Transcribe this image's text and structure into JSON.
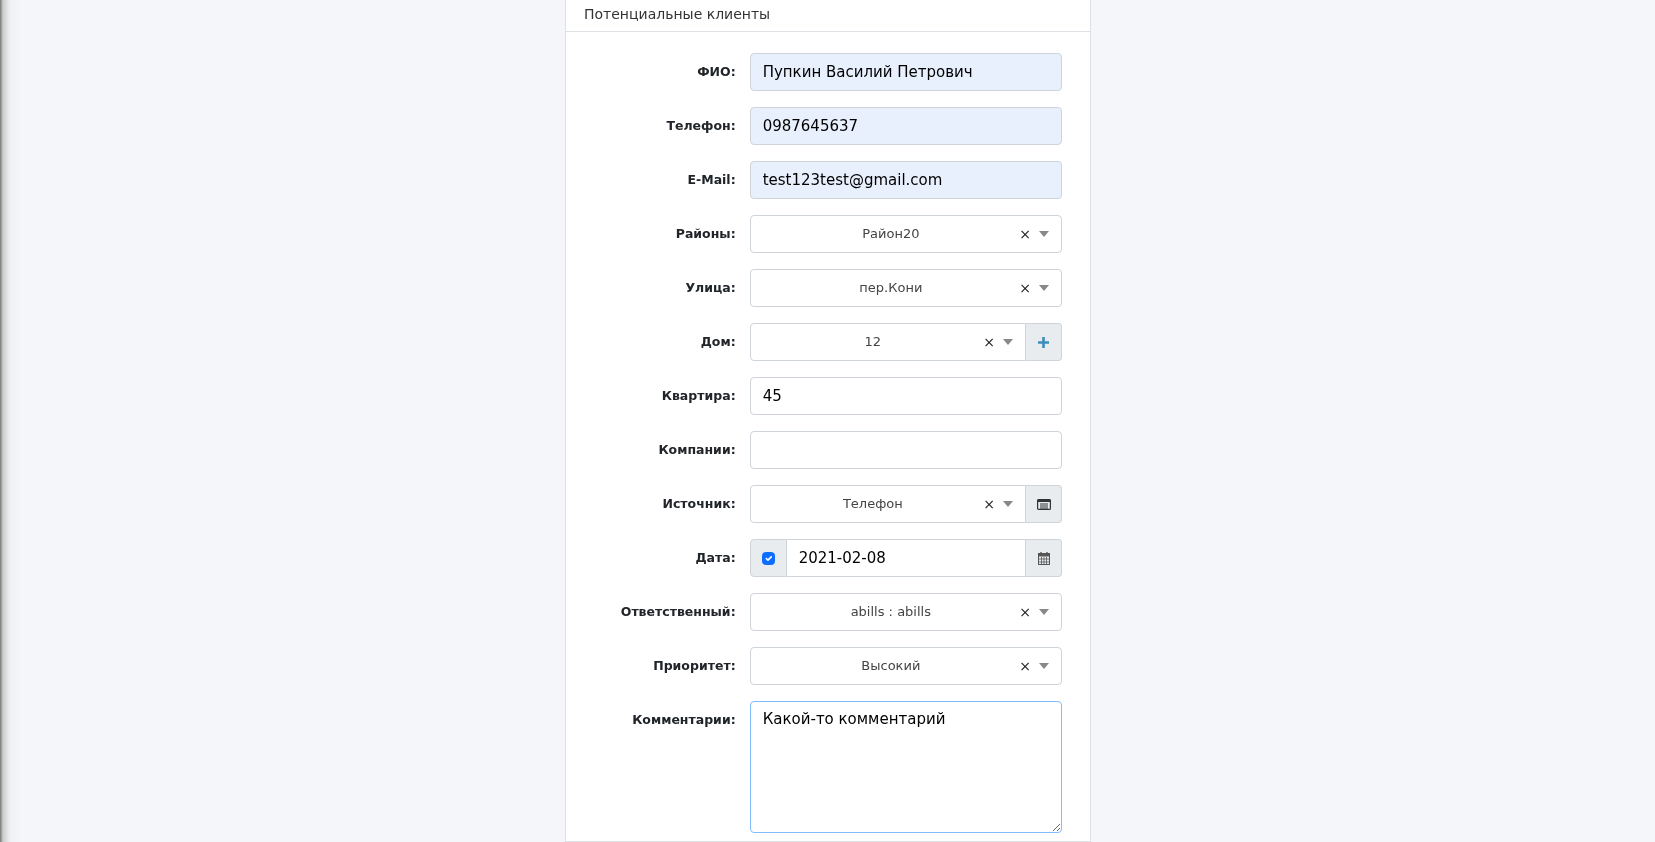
{
  "card": {
    "title": "Потенциальные клиенты"
  },
  "fields": [
    {
      "kind": "text",
      "label": "ФИО:",
      "value": "Пупкин Василий Петрович",
      "autofilled": true
    },
    {
      "kind": "text",
      "label": "Телефон:",
      "value": "0987645637",
      "autofilled": true
    },
    {
      "kind": "text",
      "label": "E-Mail:",
      "value": "test123test@gmail.com",
      "autofilled": true
    },
    {
      "kind": "select",
      "label": "Районы:",
      "value": "Район20",
      "clear": "×"
    },
    {
      "kind": "select",
      "label": "Улица:",
      "value": "пер.Кони",
      "clear": "×"
    },
    {
      "kind": "select",
      "label": "Дом:",
      "value": "12",
      "clear": "×",
      "addon": {
        "kind": "plus"
      }
    },
    {
      "kind": "text",
      "label": "Квартира:",
      "value": "45",
      "autofilled": false
    },
    {
      "kind": "text",
      "label": "Компании:",
      "autofilled": false
    },
    {
      "kind": "select",
      "label": "Источник:",
      "value": "Телефон",
      "clear": "×",
      "addon": {
        "kind": "list"
      }
    },
    {
      "kind": "date",
      "label": "Дата:",
      "value": "2021-02-08",
      "checked": true
    },
    {
      "kind": "select",
      "label": "Ответственный:",
      "value": "abills : abills",
      "clear": "×"
    },
    {
      "kind": "select",
      "label": "Приоритет:",
      "value": "Высокий",
      "clear": "×"
    },
    {
      "kind": "textarea",
      "label": "Комментарии:",
      "value": "Какой-то комментарий",
      "focused": true
    }
  ]
}
